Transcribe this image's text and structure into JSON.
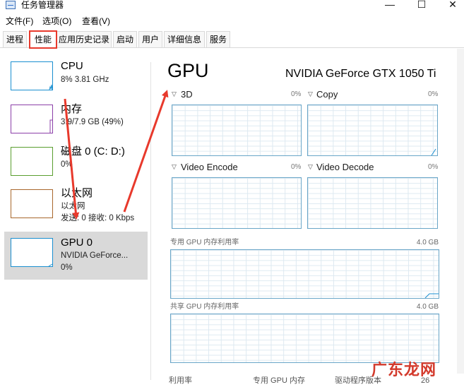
{
  "window": {
    "title": "任务管理器",
    "controls": {
      "minimize": "—",
      "maximize": "☐",
      "close": "✕"
    }
  },
  "menu": [
    "文件(F)",
    "选项(O)",
    "查看(V)"
  ],
  "tabs": [
    {
      "label": "进程",
      "active": false
    },
    {
      "label": "性能",
      "active": true
    },
    {
      "label": "应用历史记录",
      "active": false
    },
    {
      "label": "启动",
      "active": false
    },
    {
      "label": "用户",
      "active": false
    },
    {
      "label": "详细信息",
      "active": false
    },
    {
      "label": "服务",
      "active": false
    }
  ],
  "sidebar": {
    "items": [
      {
        "title": "CPU",
        "sub1": "8%  3.81 GHz",
        "sub2": "",
        "color": "#1a8fd0",
        "selected": false
      },
      {
        "title": "内存",
        "sub1": "3.9/7.9 GB (49%)",
        "sub2": "",
        "color": "#8b3fa8",
        "selected": false
      },
      {
        "title": "磁盘 0 (C: D:)",
        "sub1": "0%",
        "sub2": "",
        "color": "#5a9e2f",
        "selected": false
      },
      {
        "title": "以太网",
        "sub1": "以太网",
        "sub2": "发送: 0  接收: 0 Kbps",
        "color": "#a8672c",
        "selected": false
      },
      {
        "title": "GPU 0",
        "sub1": "NVIDIA GeForce...",
        "sub2": "0%",
        "color": "#1a8fd0",
        "selected": true
      }
    ]
  },
  "main": {
    "title": "GPU",
    "device_name": "NVIDIA GeForce GTX 1050 Ti",
    "engines": [
      {
        "name": "3D",
        "percent": "0%"
      },
      {
        "name": "Copy",
        "percent": "0%"
      },
      {
        "name": "Video Encode",
        "percent": "0%"
      },
      {
        "name": "Video Decode",
        "percent": "0%"
      }
    ],
    "dedicated_memory": {
      "label": "专用 GPU 内存利用率",
      "max": "4.0 GB"
    },
    "shared_memory": {
      "label": "共享 GPU 内存利用率",
      "max": "4.0 GB"
    },
    "bottom_labels": [
      "利用率",
      "专用 GPU 内存",
      "驱动程序版本",
      "26"
    ]
  },
  "watermark": "广东龙网",
  "colors": {
    "accent": "#1a8fd0",
    "annotation": "#e8392c",
    "graph_border": "#6aa6c8"
  }
}
